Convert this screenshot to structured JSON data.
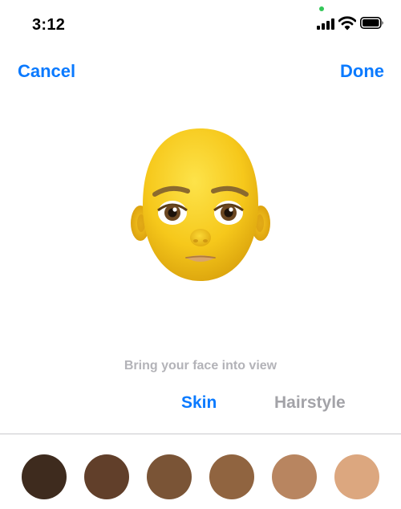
{
  "status_bar": {
    "time": "3:12",
    "privacy_dot_color": "#34c759",
    "icons": [
      "signal-bars-icon",
      "wifi-icon",
      "battery-icon"
    ]
  },
  "nav": {
    "cancel_label": "Cancel",
    "done_label": "Done"
  },
  "editor": {
    "hint": "Bring your face into view",
    "tabs": [
      {
        "label": "Skin",
        "selected": true
      },
      {
        "label": "Hairstyle",
        "selected": false
      }
    ]
  },
  "skin_swatches": [
    {
      "color": "#3e2b1e"
    },
    {
      "color": "#613f2a"
    },
    {
      "color": "#7a5436"
    },
    {
      "color": "#906440"
    },
    {
      "color": "#b88560"
    },
    {
      "color": "#dca77f"
    }
  ],
  "colors": {
    "accent": "#0a7aff",
    "tab_inactive": "#a3a3a8",
    "hint_text": "#b3b3b8",
    "face": "#f6c81b"
  }
}
